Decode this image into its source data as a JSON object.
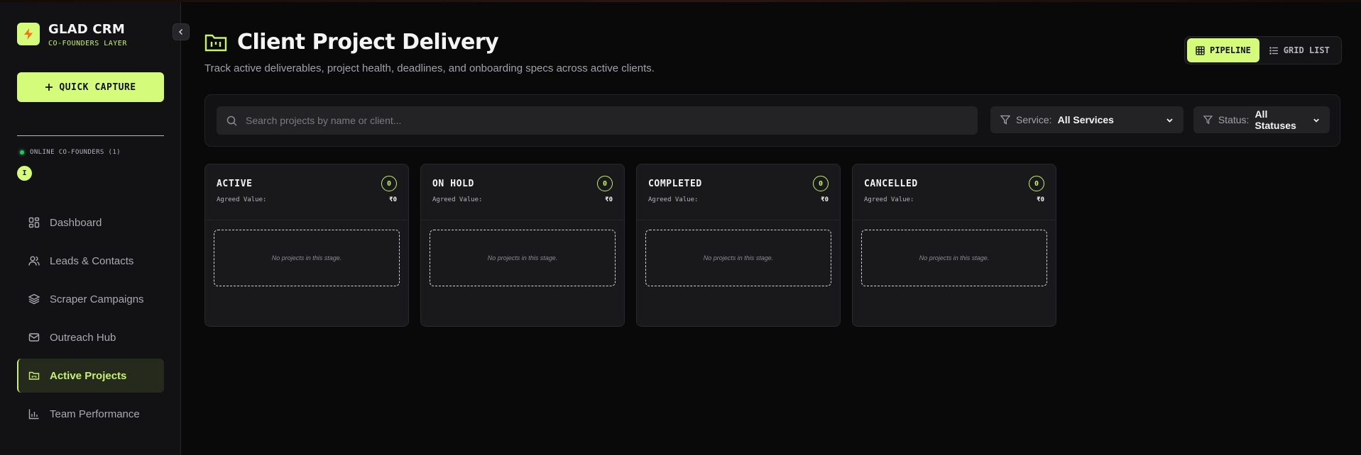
{
  "brand": {
    "title": "GLAD CRM",
    "subtitle": "CO-FOUNDERS LAYER"
  },
  "quick_capture": {
    "label": "QUICK CAPTURE"
  },
  "online": {
    "label": "ONLINE CO-FOUNDERS (1)",
    "avatar_initial": "I"
  },
  "nav": [
    {
      "label": "Dashboard",
      "icon": "dashboard-icon",
      "active": false
    },
    {
      "label": "Leads & Contacts",
      "icon": "users-icon",
      "active": false
    },
    {
      "label": "Scraper Campaigns",
      "icon": "layers-icon",
      "active": false
    },
    {
      "label": "Outreach Hub",
      "icon": "mail-icon",
      "active": false
    },
    {
      "label": "Active Projects",
      "icon": "folder-icon",
      "active": true
    },
    {
      "label": "Team Performance",
      "icon": "bar-chart-icon",
      "active": false
    }
  ],
  "header": {
    "title": "Client Project Delivery",
    "subtitle": "Track active deliverables, project health, deadlines, and onboarding specs across active clients."
  },
  "view_toggle": {
    "pipeline": "PIPELINE",
    "grid": "GRID LIST",
    "active": "pipeline"
  },
  "filters": {
    "search_placeholder": "Search projects by name or client...",
    "service_label": "Service:",
    "service_value": "All Services",
    "status_label": "Status:",
    "status_value": "All Statuses"
  },
  "columns": [
    {
      "title": "ACTIVE",
      "count": "0",
      "value_label": "Agreed Value:",
      "value": "₹0",
      "empty": "No projects in this stage."
    },
    {
      "title": "ON HOLD",
      "count": "0",
      "value_label": "Agreed Value:",
      "value": "₹0",
      "empty": "No projects in this stage."
    },
    {
      "title": "COMPLETED",
      "count": "0",
      "value_label": "Agreed Value:",
      "value": "₹0",
      "empty": "No projects in this stage."
    },
    {
      "title": "CANCELLED",
      "count": "0",
      "value_label": "Agreed Value:",
      "value": "₹0",
      "empty": "No projects in this stage."
    }
  ],
  "colors": {
    "accent": "#d4fb7a",
    "background": "#09090a",
    "sidebar": "#121214",
    "online": "#22c55e"
  }
}
